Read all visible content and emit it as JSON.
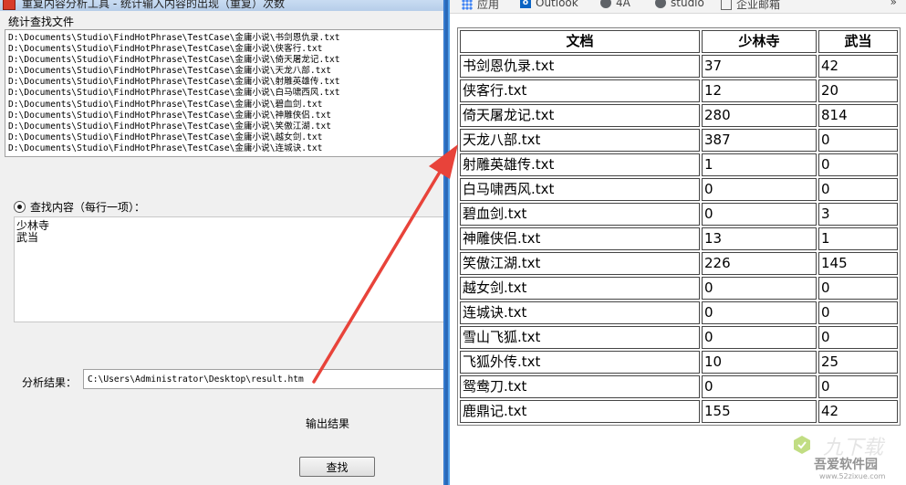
{
  "app": {
    "title": "重复内容分析工具 - 统计输入内容的出现（重复）次数",
    "files_group_label": "统计查找文件",
    "files": [
      "D:\\Documents\\Studio\\FindHotPhrase\\TestCase\\金庸小说\\书剑恩仇录.txt",
      "D:\\Documents\\Studio\\FindHotPhrase\\TestCase\\金庸小说\\侠客行.txt",
      "D:\\Documents\\Studio\\FindHotPhrase\\TestCase\\金庸小说\\倚天屠龙记.txt",
      "D:\\Documents\\Studio\\FindHotPhrase\\TestCase\\金庸小说\\天龙八部.txt",
      "D:\\Documents\\Studio\\FindHotPhrase\\TestCase\\金庸小说\\射雕英雄传.txt",
      "D:\\Documents\\Studio\\FindHotPhrase\\TestCase\\金庸小说\\白马啸西风.txt",
      "D:\\Documents\\Studio\\FindHotPhrase\\TestCase\\金庸小说\\碧血剑.txt",
      "D:\\Documents\\Studio\\FindHotPhrase\\TestCase\\金庸小说\\神雕侠侣.txt",
      "D:\\Documents\\Studio\\FindHotPhrase\\TestCase\\金庸小说\\笑傲江湖.txt",
      "D:\\Documents\\Studio\\FindHotPhrase\\TestCase\\金庸小说\\越女剑.txt",
      "D:\\Documents\\Studio\\FindHotPhrase\\TestCase\\金庸小说\\连城诀.txt"
    ],
    "query_label": "查找内容（每行一项）：",
    "queries": [
      "少林寺",
      "武当"
    ],
    "result_label": "分析结果：",
    "result_path": "C:\\Users\\Administrator\\Desktop\\result.htm",
    "output_button": "输出结果",
    "find_button": "查找"
  },
  "browser": {
    "bookmarks": [
      {
        "label": "应用",
        "icon": "apps-grid-icon"
      },
      {
        "label": "Outlook",
        "icon": "outlook-icon"
      },
      {
        "label": "4A",
        "icon": "chrome-icon"
      },
      {
        "label": "studio",
        "icon": "chrome-icon"
      },
      {
        "label": "企业邮箱",
        "icon": "mail-icon"
      }
    ],
    "more": "»",
    "table": {
      "headers": [
        "文档",
        "少林寺",
        "武当"
      ],
      "rows": [
        [
          "书剑恩仇录.txt",
          "37",
          "42"
        ],
        [
          "侠客行.txt",
          "12",
          "20"
        ],
        [
          "倚天屠龙记.txt",
          "280",
          "814"
        ],
        [
          "天龙八部.txt",
          "387",
          "0"
        ],
        [
          "射雕英雄传.txt",
          "1",
          "0"
        ],
        [
          "白马啸西风.txt",
          "0",
          "0"
        ],
        [
          "碧血剑.txt",
          "0",
          "3"
        ],
        [
          "神雕侠侣.txt",
          "13",
          "1"
        ],
        [
          "笑傲江湖.txt",
          "226",
          "145"
        ],
        [
          "越女剑.txt",
          "0",
          "0"
        ],
        [
          "连城诀.txt",
          "0",
          "0"
        ],
        [
          "雪山飞狐.txt",
          "0",
          "0"
        ],
        [
          "飞狐外传.txt",
          "10",
          "25"
        ],
        [
          "鸳鸯刀.txt",
          "0",
          "0"
        ],
        [
          "鹿鼎记.txt",
          "155",
          "42"
        ]
      ]
    }
  },
  "watermark": {
    "title": "吾爱软件园",
    "url": "www.52zixue.com",
    "overlay": "九下载"
  },
  "colors": {
    "arrow": "#e8433a",
    "taskbar_blue": "#3c8ce0",
    "window_bg": "#f0f0f0"
  }
}
